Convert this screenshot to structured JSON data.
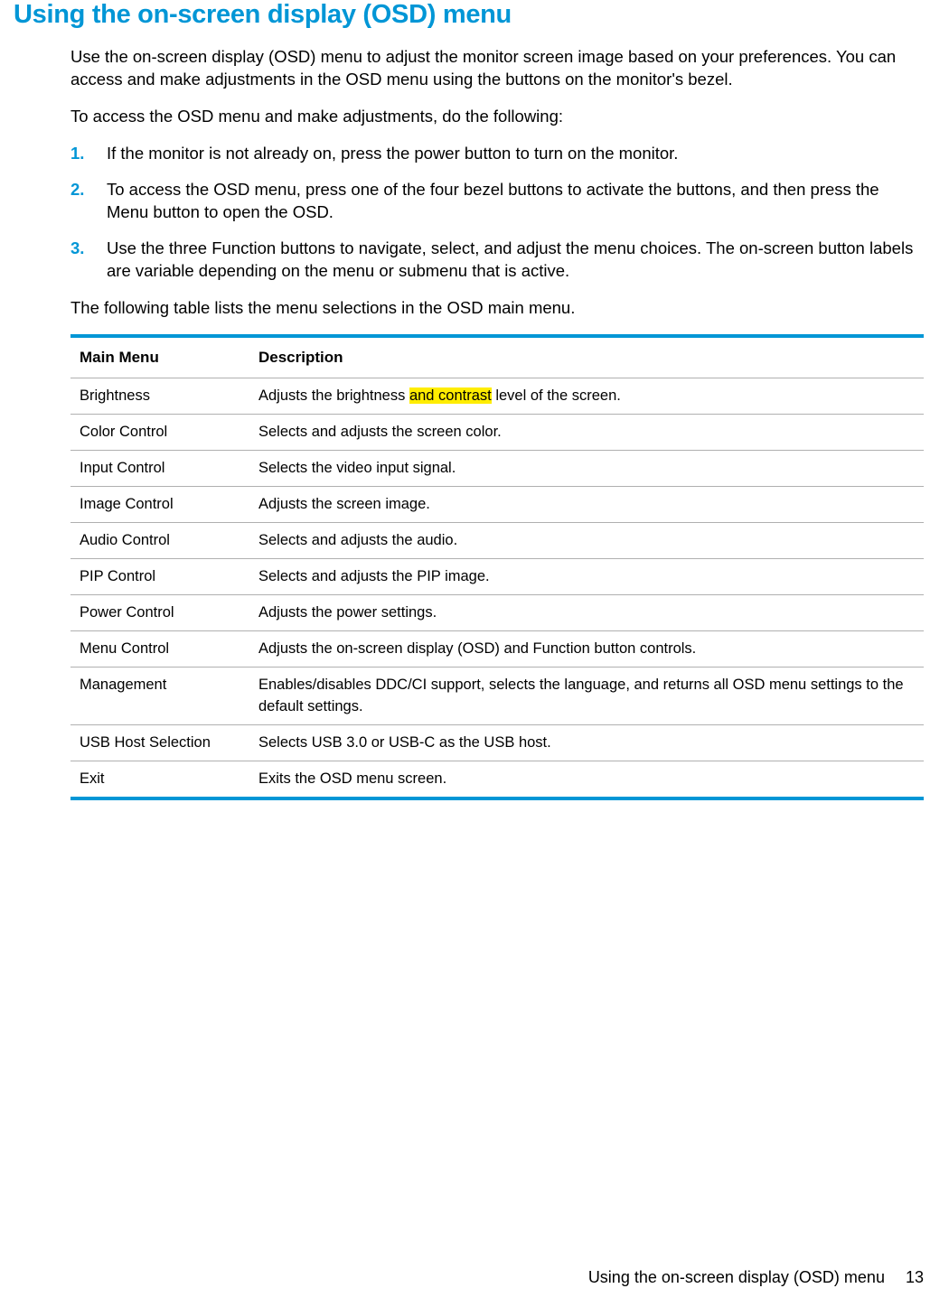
{
  "title": "Using the on-screen display (OSD) menu",
  "intro": "Use the on-screen display (OSD) menu to adjust the monitor screen image based on your preferences. You can access and make adjustments in the OSD menu using the buttons on the monitor's bezel.",
  "access_intro": "To access the OSD menu and make adjustments, do the following:",
  "steps": {
    "s1": "If the monitor is not already on, press the power button to turn on the monitor.",
    "s2": "To access the OSD menu, press one of the four bezel buttons to activate the buttons, and then press the Menu button to open the OSD.",
    "s3": "Use the three Function buttons to navigate, select, and adjust the menu choices. The on-screen button labels are variable depending on the menu or submenu that is active."
  },
  "table_intro": "The following table lists the menu selections in the OSD main menu.",
  "table": {
    "header": {
      "col1": "Main Menu",
      "col2": "Description"
    },
    "rows": {
      "r0": {
        "menu": "Brightness",
        "desc_pre": "Adjusts the brightness ",
        "desc_hl": "and contrast",
        "desc_post": " level of the screen."
      },
      "r1": {
        "menu": "Color Control",
        "desc": "Selects and adjusts the screen color."
      },
      "r2": {
        "menu": "Input Control",
        "desc": "Selects the video input signal."
      },
      "r3": {
        "menu": "Image Control",
        "desc": "Adjusts the screen image."
      },
      "r4": {
        "menu": "Audio Control",
        "desc": "Selects and adjusts the audio."
      },
      "r5": {
        "menu": "PIP Control",
        "desc": "Selects and adjusts the PIP image."
      },
      "r6": {
        "menu": "Power Control",
        "desc": "Adjusts the power settings."
      },
      "r7": {
        "menu": "Menu Control",
        "desc": "Adjusts the on-screen display (OSD) and Function button controls."
      },
      "r8": {
        "menu": "Management",
        "desc": "Enables/disables DDC/CI support, selects the language, and returns all OSD menu settings to the default settings."
      },
      "r9": {
        "menu": "USB Host Selection",
        "desc": "Selects USB 3.0 or USB-C as the USB host."
      },
      "r10": {
        "menu": "Exit",
        "desc": "Exits the OSD menu screen."
      }
    }
  },
  "footer": {
    "text": "Using the on-screen display (OSD) menu",
    "page": "13"
  }
}
